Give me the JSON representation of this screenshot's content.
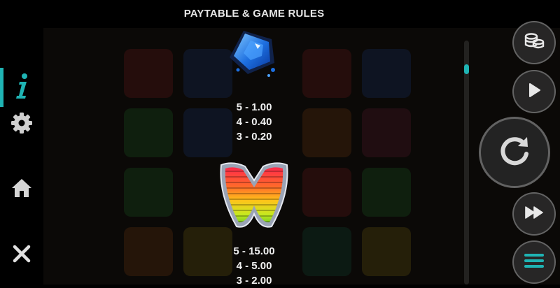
{
  "header": {
    "title": "PAYTABLE & GAME RULES"
  },
  "sidebar": {
    "items": [
      {
        "name": "info",
        "icon": "info-icon"
      },
      {
        "name": "settings",
        "icon": "gear-icon"
      },
      {
        "name": "home",
        "icon": "home-icon"
      },
      {
        "name": "close",
        "icon": "close-icon"
      }
    ]
  },
  "paytable": {
    "symbols": [
      {
        "icon": "blue-gem-icon",
        "payouts": [
          "5 - 1.00",
          "4 - 0.40",
          "3 - 0.20"
        ]
      },
      {
        "icon": "wild-w-icon",
        "payouts": [
          "5 - 15.00",
          "4 - 5.00",
          "3 - 2.00"
        ]
      }
    ]
  },
  "controls": {
    "icons": [
      "coins-icon",
      "play-icon",
      "spin-icon",
      "fast-forward-icon",
      "menu-icon"
    ]
  },
  "colors": {
    "accent": "#1fb4b4",
    "background": "#000000"
  }
}
